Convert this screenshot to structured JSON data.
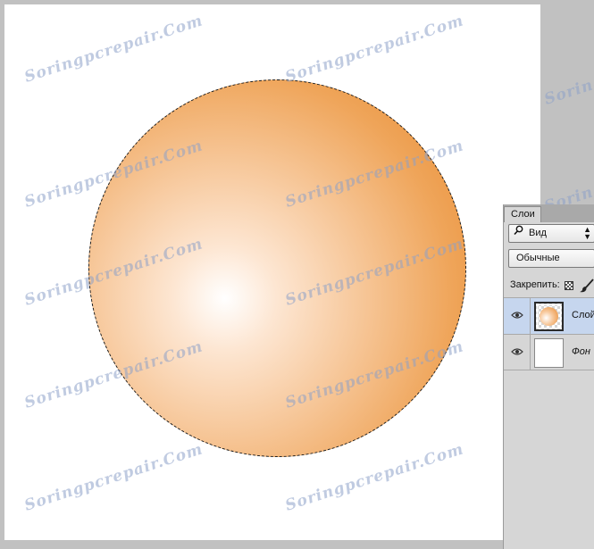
{
  "watermark": "Soringpcrepair.Com",
  "layers_panel": {
    "tab_label": "Слои",
    "filter": {
      "icon": "search-icon",
      "value": "Вид"
    },
    "blend_mode": "Обычные",
    "lock_label": "Закрепить:",
    "layers": [
      {
        "name": "Слой",
        "selected": true,
        "visible": true
      },
      {
        "name": "Фон",
        "selected": false,
        "visible": true
      }
    ]
  },
  "colors": {
    "sphere_dark": "#e8872a",
    "sphere_light": "#ffffff",
    "selected_layer_bg": "#c6d6ee",
    "workspace_bg": "#c1c1c1"
  }
}
